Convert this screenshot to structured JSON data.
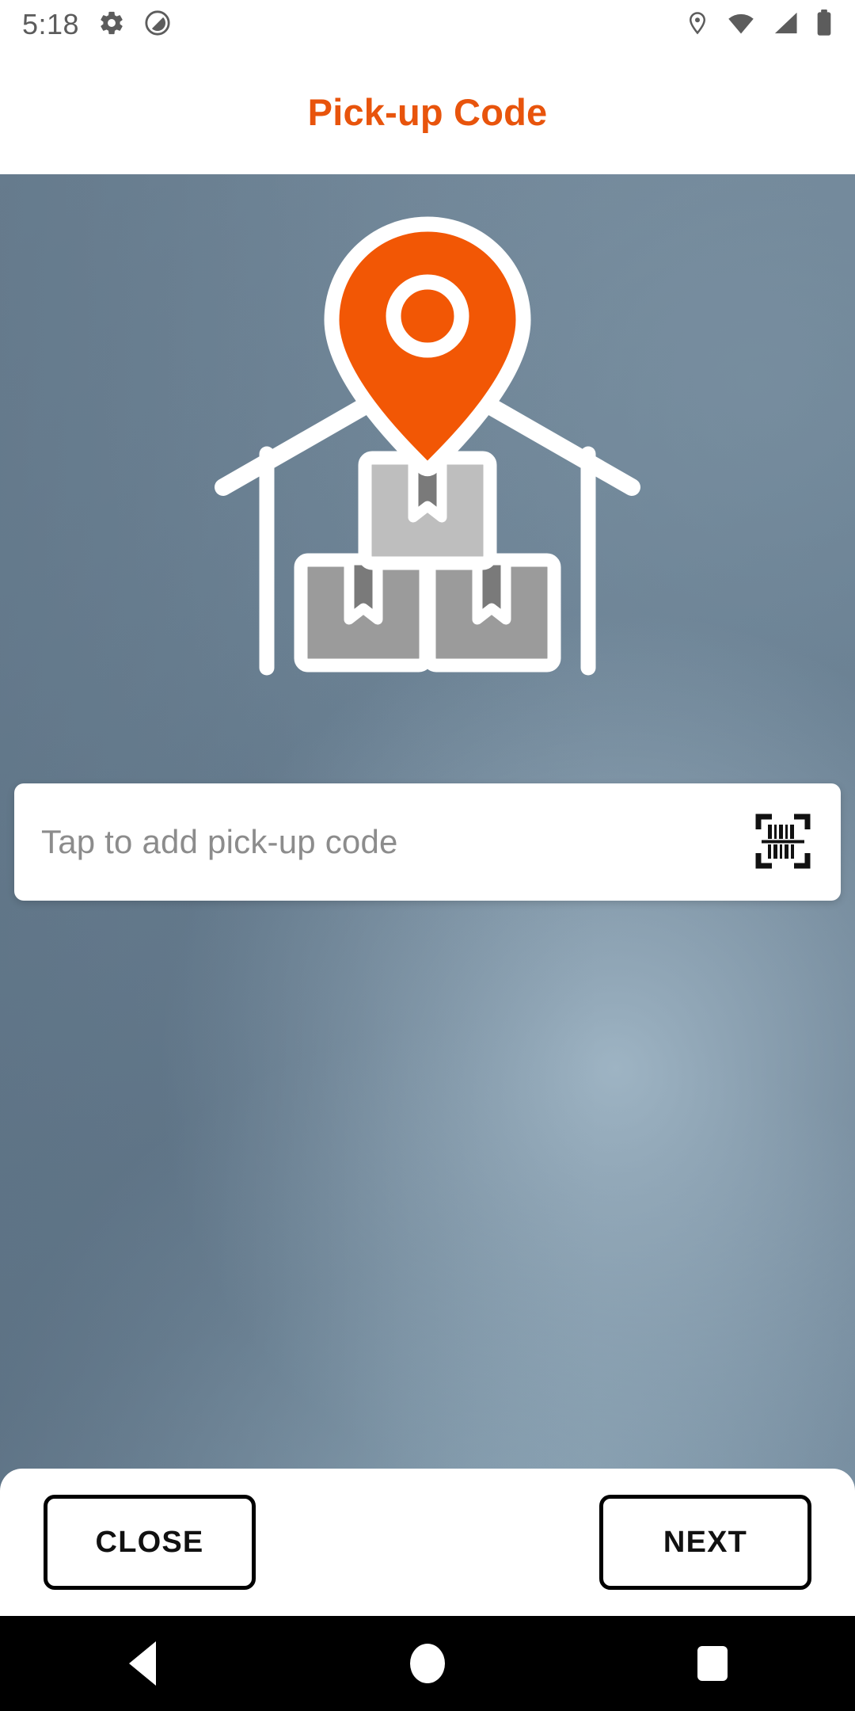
{
  "status_bar": {
    "time": "5:18",
    "left_icons": [
      "gear-icon",
      "do-not-disturb-icon"
    ],
    "right_icons": [
      "location-icon",
      "wifi-icon",
      "cellular-signal-icon",
      "battery-icon"
    ]
  },
  "header": {
    "title": "Pick-up Code",
    "title_color": "#E8540C"
  },
  "illustration": {
    "name": "warehouse-pickup-location-illustration",
    "pin_color": "#F25705",
    "outline_color": "#FFFFFF",
    "box_top_color": "#BEBEBE",
    "box_bottom_color": "#9B9B9B",
    "box_tape_color": "#7A7A7A"
  },
  "input": {
    "placeholder": "Tap to add pick-up code",
    "value": "",
    "scan_icon": "barcode-scanner-icon"
  },
  "background": {
    "base_color": "#647A8D",
    "highlight_color": "#A8BECD"
  },
  "bottom_bar": {
    "close_label": "CLOSE",
    "next_label": "NEXT"
  },
  "nav_bar": {
    "back": "back-icon",
    "home": "home-icon",
    "recents": "recents-icon"
  }
}
